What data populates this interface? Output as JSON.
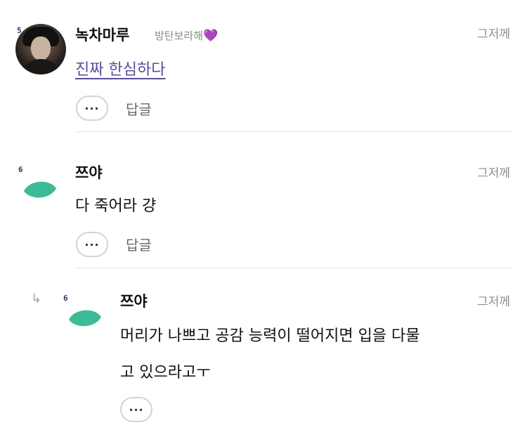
{
  "comments": [
    {
      "level": "5",
      "author": "녹차마루",
      "nickname_extra": "방탄보라해",
      "nickname_heart": "💜",
      "time": "그저께",
      "text": "진짜 한심하다",
      "more_label": "···",
      "reply_label": "답글"
    },
    {
      "level": "6",
      "author": "쯔야",
      "time": "그저께",
      "text": "다 죽어라 걍",
      "more_label": "···",
      "reply_label": "답글"
    },
    {
      "level": "6",
      "author": "쯔야",
      "time": "그저께",
      "text_line1": "머리가 나쁘고 공감 능력이 떨어지면 입을 다물",
      "text_line2": "고 있으라고ㅜ",
      "more_label": "···"
    }
  ],
  "colors": {
    "leaf": "#3dbb96",
    "link_text": "#5b4a9c",
    "heart": "#a64ee0"
  }
}
